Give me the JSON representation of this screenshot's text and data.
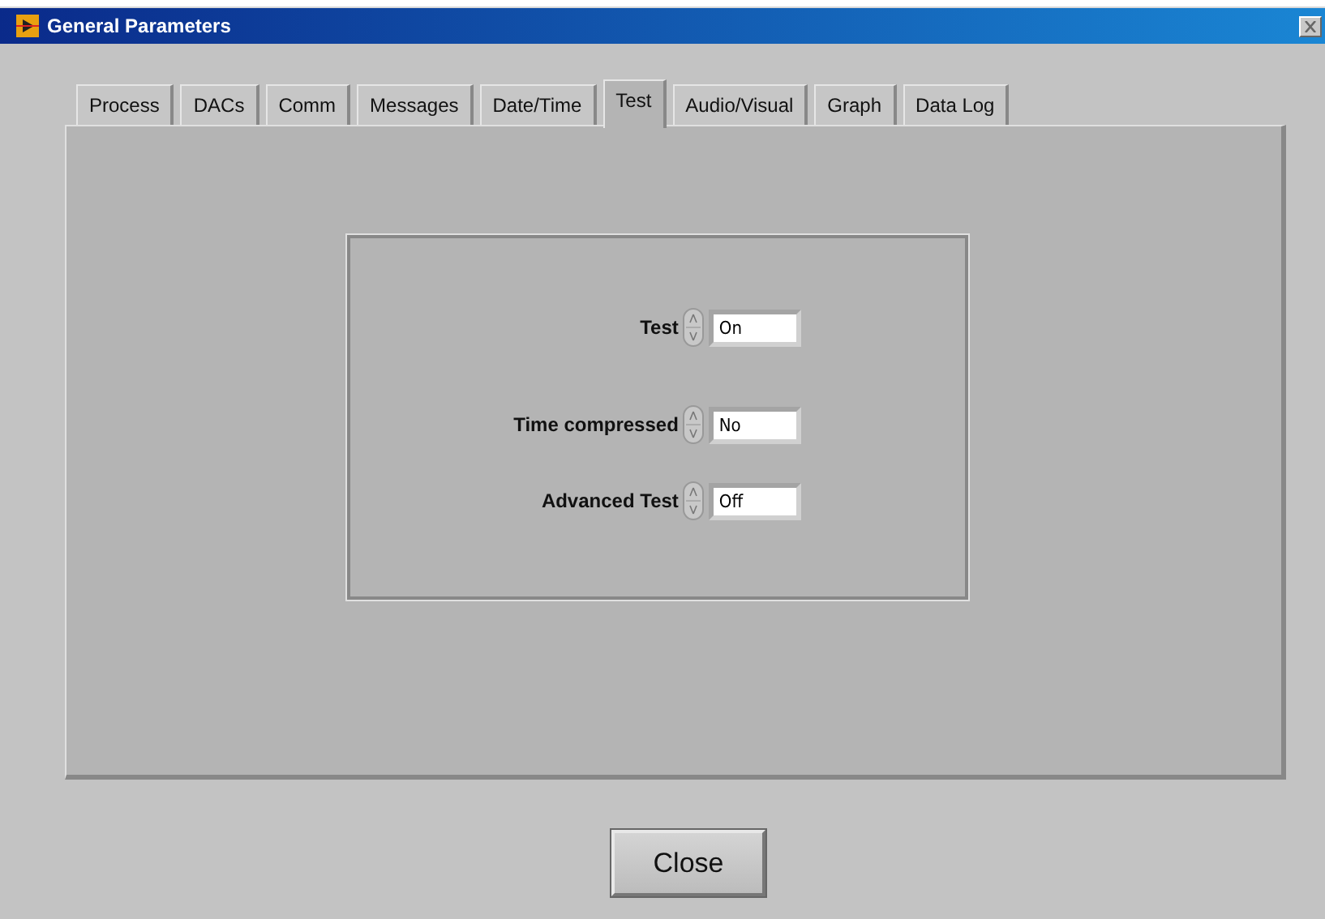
{
  "window": {
    "title": "General Parameters"
  },
  "tabs": [
    {
      "label": "Process",
      "selected": false
    },
    {
      "label": "DACs",
      "selected": false
    },
    {
      "label": "Comm",
      "selected": false
    },
    {
      "label": "Messages",
      "selected": false
    },
    {
      "label": "Date/Time",
      "selected": false
    },
    {
      "label": "Test",
      "selected": true
    },
    {
      "label": "Audio/Visual",
      "selected": false
    },
    {
      "label": "Graph",
      "selected": false
    },
    {
      "label": "Data Log",
      "selected": false
    }
  ],
  "settings": [
    {
      "label": "Test",
      "value": "On"
    },
    {
      "label": "Time compressed",
      "value": "No"
    },
    {
      "label": "Advanced Test",
      "value": "Off"
    }
  ],
  "buttons": [
    "Close"
  ]
}
